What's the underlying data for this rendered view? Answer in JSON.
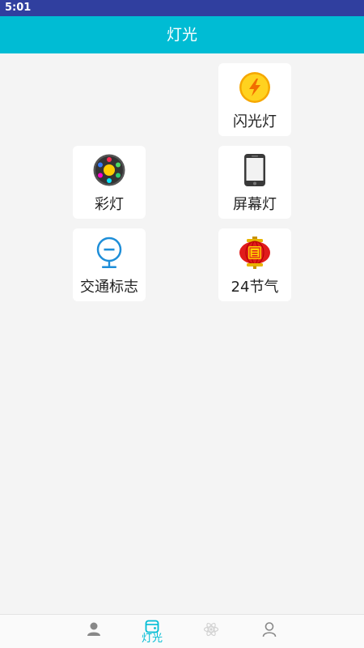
{
  "status_bar": {
    "time": "5:01"
  },
  "app_bar": {
    "title": "灯光"
  },
  "tiles": [
    {
      "label": "闪光灯",
      "icon": "flash-icon"
    },
    {
      "label": "彩灯",
      "icon": "color-lights-icon"
    },
    {
      "label": "屏幕灯",
      "icon": "phone-screen-icon"
    },
    {
      "label": "交通标志",
      "icon": "traffic-sign-icon"
    },
    {
      "label": "24节气",
      "icon": "lantern-icon"
    }
  ],
  "bottom_nav": {
    "items": [
      {
        "icon": "person-icon",
        "label": ""
      },
      {
        "icon": "wallet-icon",
        "label": "灯光",
        "active": true
      },
      {
        "icon": "atom-icon",
        "label": ""
      },
      {
        "icon": "profile-icon",
        "label": ""
      }
    ]
  },
  "colors": {
    "status_bar": "#303f9f",
    "app_bar": "#00bcd4",
    "active_tab": "#00bcd4",
    "background": "#f4f4f4"
  }
}
